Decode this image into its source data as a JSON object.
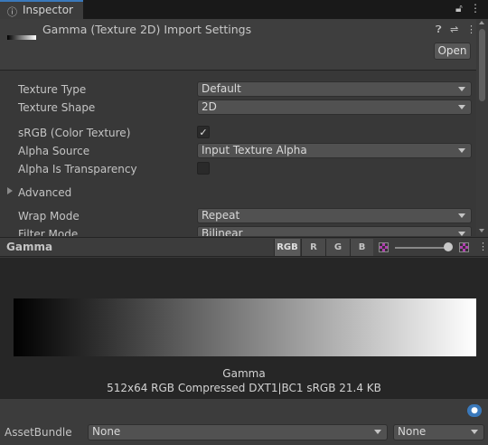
{
  "tab": {
    "icon": "info-icon",
    "label": "Inspector"
  },
  "tab_buttons": {
    "lock": "lock-icon",
    "menu": "kebab-menu-icon"
  },
  "header": {
    "title": "Gamma (Texture 2D) Import Settings",
    "open_label": "Open",
    "icons": [
      "help-icon",
      "preset-icon",
      "kebab-menu-icon"
    ]
  },
  "settings": {
    "texture_type": {
      "label": "Texture Type",
      "value": "Default"
    },
    "texture_shape": {
      "label": "Texture Shape",
      "value": "2D"
    },
    "srgb": {
      "label": "sRGB (Color Texture)",
      "checked": true,
      "mark": "✓"
    },
    "alpha_source": {
      "label": "Alpha Source",
      "value": "Input Texture Alpha"
    },
    "alpha_is_transparency": {
      "label": "Alpha Is Transparency",
      "checked": false
    },
    "advanced": {
      "label": "Advanced",
      "expanded": false
    },
    "wrap_mode": {
      "label": "Wrap Mode",
      "value": "Repeat"
    },
    "filter_mode": {
      "label": "Filter Mode",
      "value": "Bilinear"
    }
  },
  "preview": {
    "title": "Gamma",
    "channels": [
      "RGB",
      "R",
      "G",
      "B"
    ],
    "active_channel": "RGB",
    "mip_slider": 1.0,
    "name": "Gamma",
    "info": "512x64  RGB Compressed DXT1|BC1 sRGB   21.4 KB",
    "gradient": {
      "from": "#000000",
      "to": "#ffffff"
    }
  },
  "asset_bundle": {
    "label": "AssetBundle",
    "name_value": "None",
    "variant_value": "None"
  },
  "colors": {
    "accent": "#3a79bb",
    "background": "#383838",
    "preview_bg": "#262626"
  }
}
